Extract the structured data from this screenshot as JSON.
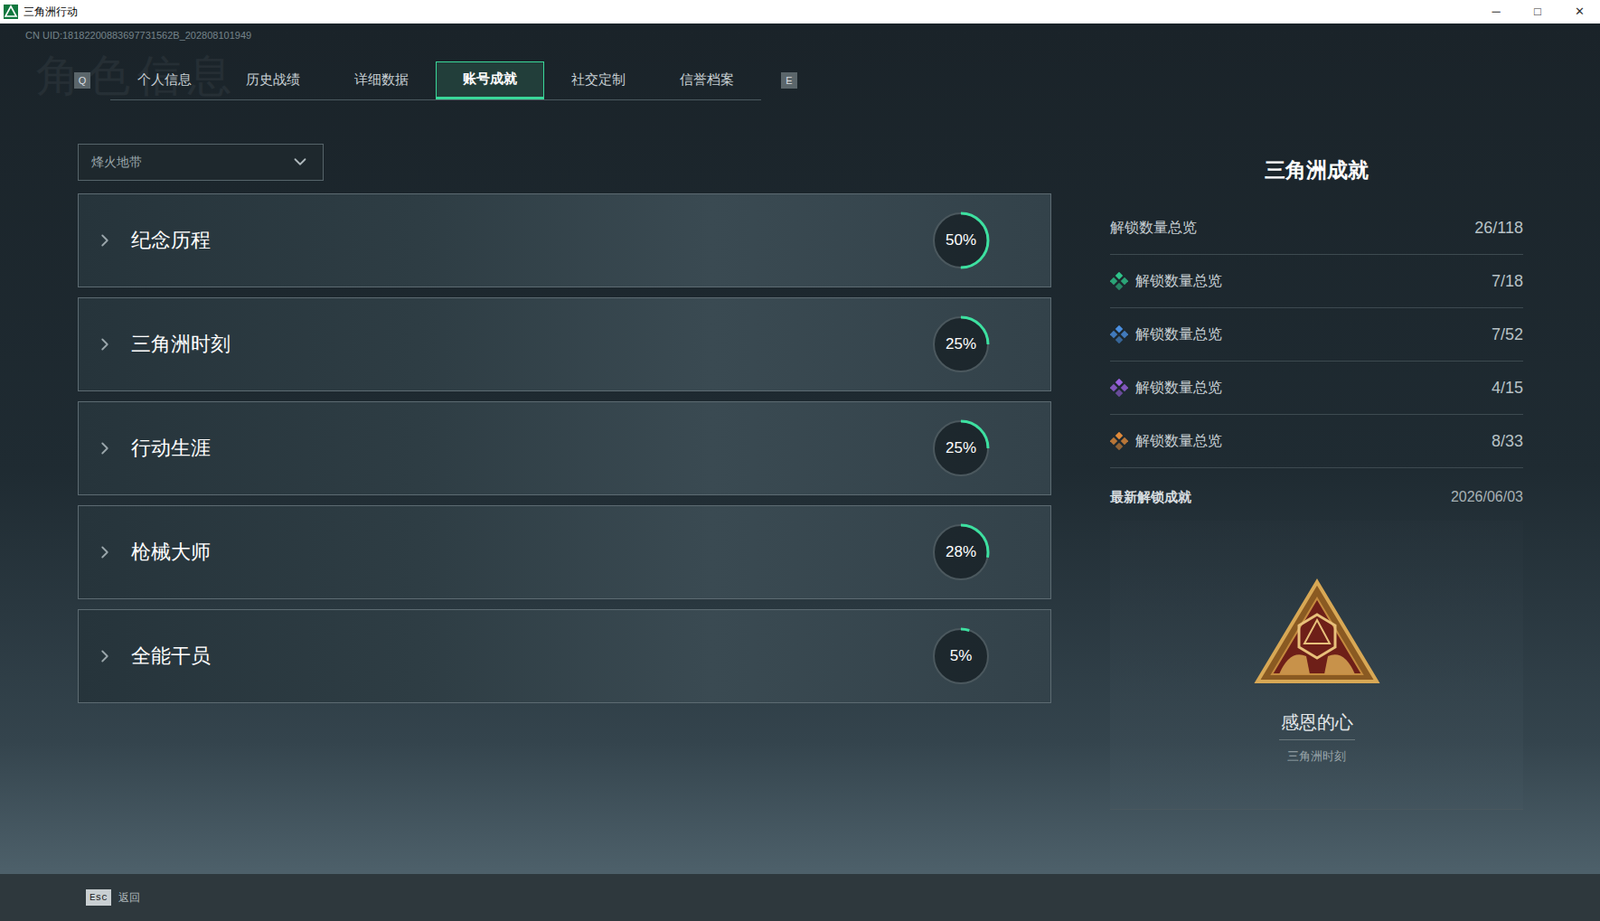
{
  "window": {
    "title": "三角洲行动",
    "controls": [
      "─",
      "□",
      "✕"
    ]
  },
  "uid": "CN UID:18182200883697731562B_202808101949",
  "watermark": "角色信息",
  "tab_keys": {
    "prev": "Q",
    "next": "E"
  },
  "tabs": [
    {
      "label": "个人信息",
      "selected": false
    },
    {
      "label": "历史战绩",
      "selected": false
    },
    {
      "label": "详细数据",
      "selected": false
    },
    {
      "label": "账号成就",
      "selected": true
    },
    {
      "label": "社交定制",
      "selected": false
    },
    {
      "label": "信誉档案",
      "selected": false
    }
  ],
  "mode_select": {
    "value": "烽火地带"
  },
  "categories": [
    {
      "title": "纪念历程",
      "percent": "50%",
      "level": 0.5
    },
    {
      "title": "三角洲时刻",
      "percent": "25%",
      "level": 0.25
    },
    {
      "title": "行动生涯",
      "percent": "25%",
      "level": 0.25
    },
    {
      "title": "枪械大师",
      "percent": "28%",
      "level": 0.28
    },
    {
      "title": "全能干员",
      "percent": "5%",
      "level": 0.05
    }
  ],
  "summary": {
    "title": "三角洲成就",
    "total": {
      "label": "解锁数量总览",
      "value": "26/118"
    },
    "tiers": [
      {
        "label": "解锁数量总览",
        "value": "7/18",
        "color": "#2fc48a"
      },
      {
        "label": "解锁数量总览",
        "value": "7/52",
        "color": "#4a8fe0"
      },
      {
        "label": "解锁数量总览",
        "value": "4/15",
        "color": "#9a62e0"
      },
      {
        "label": "解锁数量总览",
        "value": "8/33",
        "color": "#e08a3a"
      }
    ]
  },
  "latest": {
    "label": "最新解锁成就",
    "date": "2026/06/03",
    "name": "感恩的心",
    "category": "三角洲时刻"
  },
  "footer": {
    "key": "Esc",
    "label": "返回"
  }
}
